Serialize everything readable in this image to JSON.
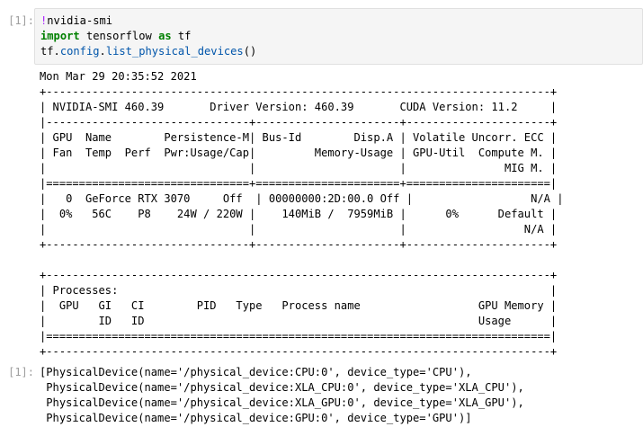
{
  "input_prompt": "[1]:",
  "output_prompt": "[1]:",
  "code": {
    "line1_bang": "!",
    "line1_cmd": "nvidia-smi",
    "line2_kw_import": "import",
    "line2_module": " tensorflow ",
    "line2_kw_as": "as",
    "line2_alias": " tf",
    "line3_prefix": "tf.",
    "line3_config": "config",
    "line3_dot": ".",
    "line3_func": "list_physical_devices",
    "line3_parens": "()"
  },
  "nvidia_smi_output": "Mon Mar 29 20:35:52 2021\n+-----------------------------------------------------------------------------+\n| NVIDIA-SMI 460.39       Driver Version: 460.39       CUDA Version: 11.2     |\n|-------------------------------+----------------------+----------------------+\n| GPU  Name        Persistence-M| Bus-Id        Disp.A | Volatile Uncorr. ECC |\n| Fan  Temp  Perf  Pwr:Usage/Cap|         Memory-Usage | GPU-Util  Compute M. |\n|                               |                      |               MIG M. |\n|===============================+======================+======================|\n|   0  GeForce RTX 3070     Off  | 00000000:2D:00.0 Off |                  N/A |\n|  0%   56C    P8    24W / 220W |    140MiB /  7959MiB |      0%      Default |\n|                               |                      |                  N/A |\n+-------------------------------+----------------------+----------------------+\n\n+-----------------------------------------------------------------------------+\n| Processes:                                                                  |\n|  GPU   GI   CI        PID   Type   Process name                  GPU Memory |\n|        ID   ID                                                   Usage      |\n|=============================================================================|\n+-----------------------------------------------------------------------------+",
  "result_output": "[PhysicalDevice(name='/physical_device:CPU:0', device_type='CPU'),\n PhysicalDevice(name='/physical_device:XLA_CPU:0', device_type='XLA_CPU'),\n PhysicalDevice(name='/physical_device:XLA_GPU:0', device_type='XLA_GPU'),\n PhysicalDevice(name='/physical_device:GPU:0', device_type='GPU')]"
}
